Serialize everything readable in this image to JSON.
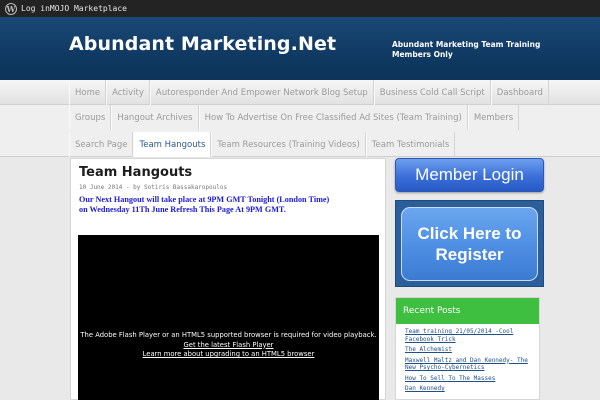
{
  "adminbar": {
    "links": "Log inMOJO Marketplace"
  },
  "header": {
    "title": "Abundant Marketing.Net",
    "tagline": "Abundant Marketing Team Training Members Only"
  },
  "nav": {
    "row1": [
      "Home",
      "Activity",
      "Autoresponder And Empower Network Blog Setup",
      "Business Cold Call Script",
      "Dashboard"
    ],
    "row2": [
      "Groups",
      "Hangout Archives",
      "How To Advertise On Free Classified Ad Sites (Team Training)",
      "Members"
    ],
    "row3": [
      "Search Page",
      "Team Hangouts",
      "Team Resources (Training Videos)",
      "Team Testimonials"
    ],
    "active": "Team Hangouts"
  },
  "post": {
    "title": "Team Hangouts",
    "meta": "10 June 2014 - by Sotiris Bassakaropoulos",
    "notice_line1": "Our Next Hangout will take place at 9PM GMT Tonight (London Time)",
    "notice_line2": "on Wednesday 11Th June Refresh This Page At 9PM GMT.",
    "video_msg": "The Adobe Flash Player or an HTML5 supported browser is required for video playback.",
    "video_link1": "Get the latest Flash Player",
    "video_link2": "Learn more about upgrading to an HTML5 browser"
  },
  "sidebar": {
    "login_label": "Member Login",
    "register_line1": "Click Here to",
    "register_line2": "Register",
    "recent_title": "Recent Posts",
    "recent_posts": [
      "Team training 21/05/2014 -Cool Facebook Trick",
      "The Alchemist",
      "Maxwell Maltz and Dan Kennedy- The New Psycho-Cybernetics",
      "How To Sell To The Masses",
      "Dan Kennedy"
    ]
  },
  "colors": {
    "header_blue": "#103a63",
    "accent_green": "#3fbf3f",
    "button_blue": "#3b6fd8"
  }
}
